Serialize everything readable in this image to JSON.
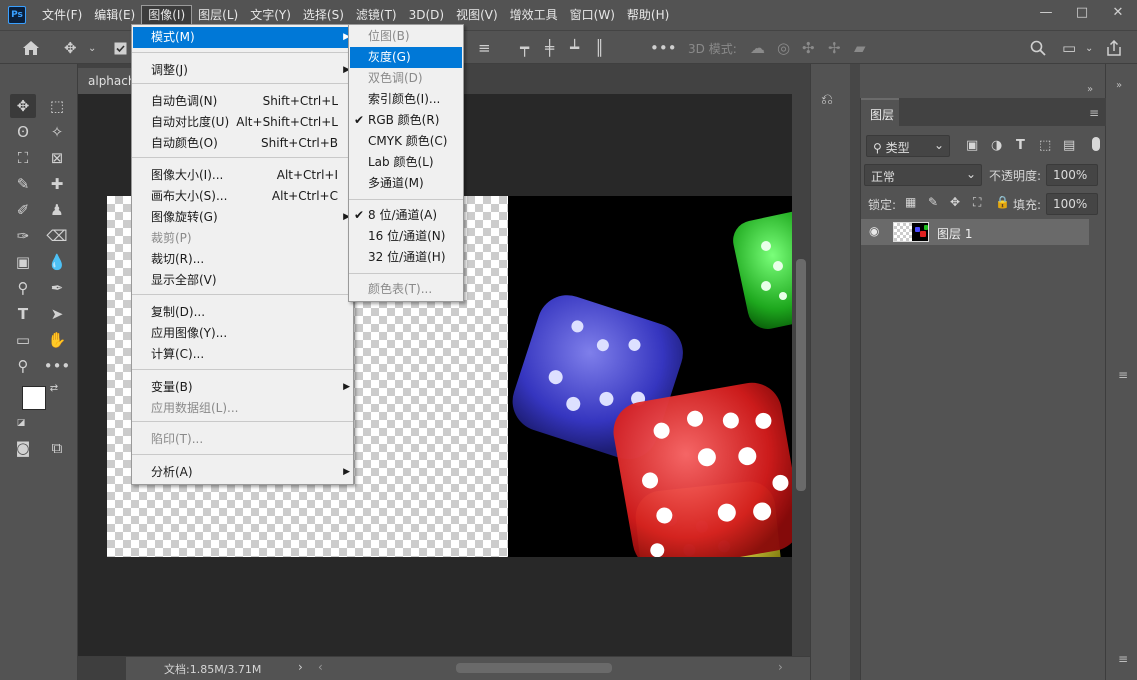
{
  "app": {
    "logo_text": "Ps"
  },
  "menubar": {
    "items": [
      "文件(F)",
      "编辑(E)",
      "图像(I)",
      "图层(L)",
      "文字(Y)",
      "选择(S)",
      "滤镜(T)",
      "3D(D)",
      "视图(V)",
      "增效工具",
      "窗口(W)",
      "帮助(H)"
    ],
    "active_index": 2,
    "window_controls": [
      "—",
      "□",
      "✕"
    ]
  },
  "options_bar": {
    "mode3d_label": "3D 模式:",
    "icons": [
      "home-icon",
      "move-icon",
      "checkbox-icon",
      "align-icon",
      "more-icon",
      "search-icon",
      "workspace-icon",
      "share-icon"
    ]
  },
  "document": {
    "tab_label": "alphacha",
    "status": "文档:1.85M/3.71M"
  },
  "image_menu": {
    "items": [
      {
        "label": "模式(M)",
        "shortcut": "",
        "submenu": true,
        "disabled": false,
        "highlight": true
      },
      {
        "label": "调整(J)",
        "shortcut": "",
        "submenu": true,
        "disabled": false
      },
      {
        "label": "自动色调(N)",
        "shortcut": "Shift+Ctrl+L",
        "disabled": false
      },
      {
        "label": "自动对比度(U)",
        "shortcut": "Alt+Shift+Ctrl+L",
        "disabled": false
      },
      {
        "label": "自动颜色(O)",
        "shortcut": "Shift+Ctrl+B",
        "disabled": false
      },
      {
        "label": "图像大小(I)...",
        "shortcut": "Alt+Ctrl+I",
        "disabled": false
      },
      {
        "label": "画布大小(S)...",
        "shortcut": "Alt+Ctrl+C",
        "disabled": false
      },
      {
        "label": "图像旋转(G)",
        "shortcut": "",
        "submenu": true,
        "disabled": false
      },
      {
        "label": "裁剪(P)",
        "shortcut": "",
        "disabled": true
      },
      {
        "label": "裁切(R)...",
        "shortcut": "",
        "disabled": false
      },
      {
        "label": "显示全部(V)",
        "shortcut": "",
        "disabled": false
      },
      {
        "label": "复制(D)...",
        "shortcut": "",
        "disabled": false
      },
      {
        "label": "应用图像(Y)...",
        "shortcut": "",
        "disabled": false
      },
      {
        "label": "计算(C)...",
        "shortcut": "",
        "disabled": false
      },
      {
        "label": "变量(B)",
        "shortcut": "",
        "submenu": true,
        "disabled": false
      },
      {
        "label": "应用数据组(L)...",
        "shortcut": "",
        "disabled": true
      },
      {
        "label": "陷印(T)...",
        "shortcut": "",
        "disabled": true
      },
      {
        "label": "分析(A)",
        "shortcut": "",
        "submenu": true,
        "disabled": false
      }
    ]
  },
  "mode_submenu": {
    "items": [
      {
        "label": "位图(B)",
        "disabled": true
      },
      {
        "label": "灰度(G)",
        "disabled": false,
        "highlight": true
      },
      {
        "label": "双色调(D)",
        "disabled": true
      },
      {
        "label": "索引颜色(I)...",
        "disabled": false
      },
      {
        "label": "RGB 颜色(R)",
        "disabled": false,
        "checked": true
      },
      {
        "label": "CMYK 颜色(C)",
        "disabled": false
      },
      {
        "label": "Lab 颜色(L)",
        "disabled": false
      },
      {
        "label": "多通道(M)",
        "disabled": false
      },
      {
        "label": "8 位/通道(A)",
        "disabled": false,
        "checked": true
      },
      {
        "label": "16 位/通道(N)",
        "disabled": false
      },
      {
        "label": "32 位/通道(H)",
        "disabled": false
      },
      {
        "label": "颜色表(T)...",
        "disabled": true
      }
    ],
    "check_mark": "✔"
  },
  "layers_panel": {
    "tab_label": "图层",
    "filter_label": "类型",
    "blend_mode": "正常",
    "opacity_label": "不透明度:",
    "opacity_value": "100%",
    "lock_label": "锁定:",
    "fill_label": "填充:",
    "fill_value": "100%",
    "layer_name": "图层 1"
  },
  "colors": {
    "highlight": "#0078d7",
    "menu_bg": "#f0f0f0",
    "ui_bg": "#535353"
  }
}
